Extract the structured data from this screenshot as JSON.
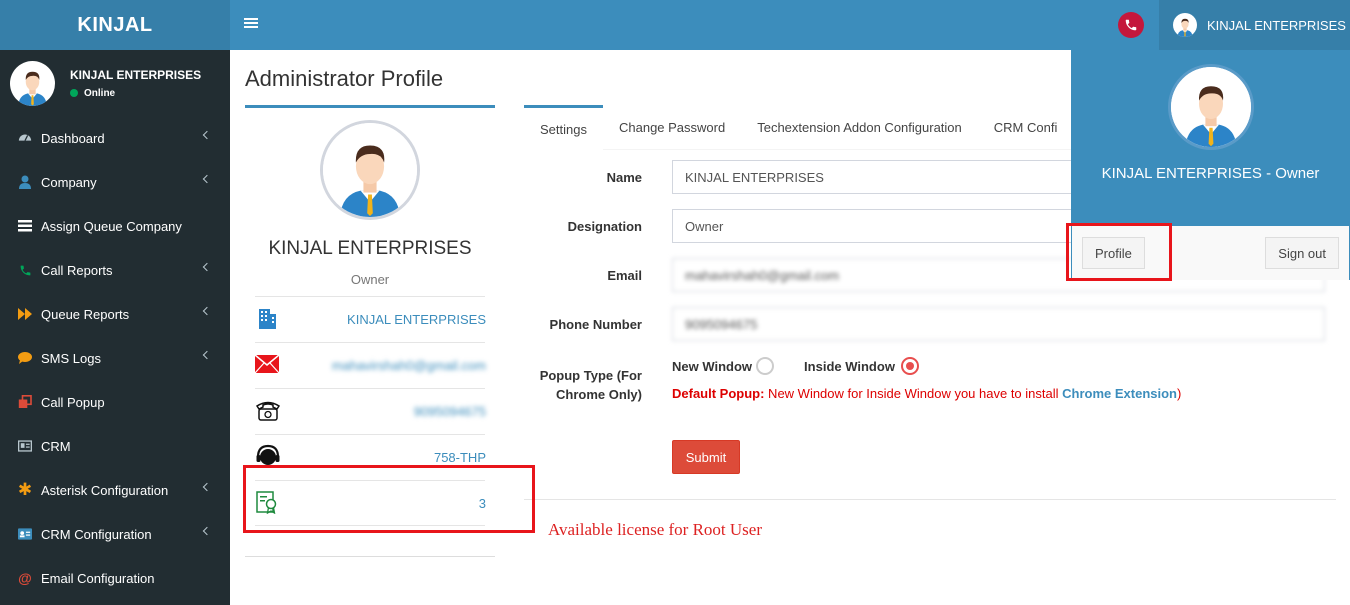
{
  "brand": {
    "logo": "KINJAL"
  },
  "header": {
    "user_name": "KINJAL ENTERPRISES"
  },
  "sidebar": {
    "user": {
      "name": "KINJAL ENTERPRISES",
      "status": "Online"
    },
    "items": [
      {
        "label": "Dashboard",
        "icon": "dashboard-icon"
      },
      {
        "label": "Company",
        "icon": "user-icon"
      },
      {
        "label": "Assign Queue Company",
        "icon": "list-icon"
      },
      {
        "label": "Call Reports",
        "icon": "phone-icon"
      },
      {
        "label": "Queue Reports",
        "icon": "fast-forward-icon"
      },
      {
        "label": "SMS Logs",
        "icon": "comment-icon"
      },
      {
        "label": "Call Popup",
        "icon": "popup-icon"
      },
      {
        "label": "CRM",
        "icon": "id-card-icon"
      },
      {
        "label": "Asterisk Configuration",
        "icon": "asterisk-icon"
      },
      {
        "label": "CRM Configuration",
        "icon": "address-card-icon"
      },
      {
        "label": "Email Configuration",
        "icon": "at-icon"
      }
    ]
  },
  "page": {
    "title": "Administrator Profile"
  },
  "profile": {
    "name": "KINJAL ENTERPRISES",
    "role": "Owner",
    "company": "KINJAL ENTERPRISES",
    "email": "mahavirshah0@gmail.com",
    "phone": "9095094675",
    "extension": "758-THP",
    "licenses": "3"
  },
  "tabs": [
    "Settings",
    "Change Password",
    "Techextension Addon Configuration",
    "CRM Confi"
  ],
  "form": {
    "name_label": "Name",
    "name_value": "KINJAL ENTERPRISES",
    "designation_label": "Designation",
    "designation_value": "Owner",
    "email_label": "Email",
    "email_value": "mahavirshah0@gmail.com",
    "phone_label": "Phone Number",
    "phone_value": "9095094675",
    "popup_label_1": "Popup Type (For",
    "popup_label_2": "Chrome Only)",
    "new_window": "New Window",
    "inside_window": "Inside Window",
    "note_prefix": "Default Popup:",
    "note_text": " New Window for Inside Window you have to install ",
    "note_link": "Chrome Extension",
    "note_suffix": ")",
    "submit": "Submit"
  },
  "dropdown": {
    "name": "KINJAL ENTERPRISES - Owner",
    "profile_btn": "Profile",
    "signout_btn": "Sign out"
  },
  "annotation": "Available license for Root User",
  "colors": {
    "primary": "#3c8dbc",
    "sidebar": "#222d32",
    "danger": "#dd4b39",
    "highlight": "#e8151b"
  }
}
